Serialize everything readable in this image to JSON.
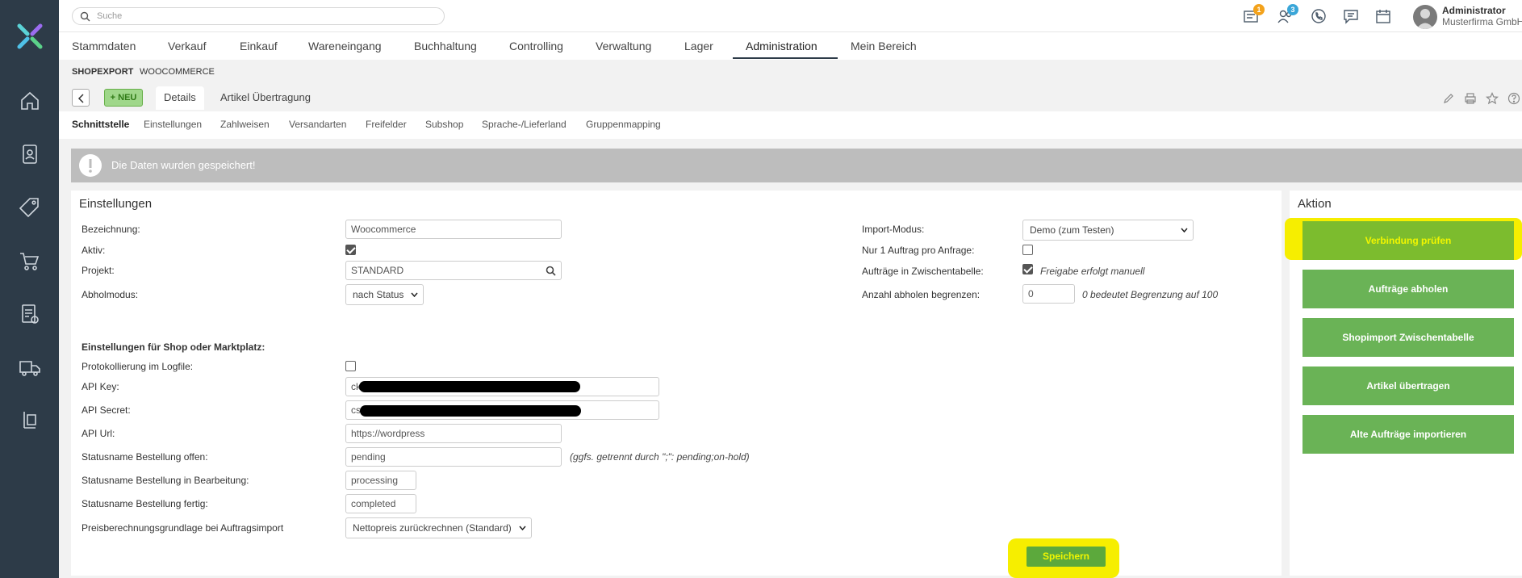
{
  "search": {
    "placeholder": "Suche"
  },
  "header": {
    "badges": {
      "tasks": "1",
      "users": "3"
    },
    "user_name": "Administrator",
    "user_company": "Musterfirma GmbH"
  },
  "nav": {
    "items": [
      "Stammdaten",
      "Verkauf",
      "Einkauf",
      "Wareneingang",
      "Buchhaltung",
      "Controlling",
      "Verwaltung",
      "Lager",
      "Administration",
      "Mein Bereich"
    ],
    "active": "Administration"
  },
  "breadcrumb": {
    "module": "SHOPEXPORT",
    "shop": "WOOCOMMERCE"
  },
  "tabs": {
    "new_label": "+ NEU",
    "details": "Details",
    "transfer": "Artikel Übertragung"
  },
  "subnav": [
    "Schnittstelle",
    "Einstellungen",
    "Zahlweisen",
    "Versandarten",
    "Freifelder",
    "Subshop",
    "Sprache-/Lieferland",
    "Gruppenmapping"
  ],
  "alert": {
    "text": "Die Daten wurden gespeichert!"
  },
  "settings": {
    "title": "Einstellungen",
    "bezeichnung_label": "Bezeichnung:",
    "bezeichnung_value": "Woocommerce",
    "aktiv_label": "Aktiv:",
    "projekt_label": "Projekt:",
    "projekt_value": "STANDARD",
    "abholmodus_label": "Abholmodus:",
    "abholmodus_value": "nach Status",
    "import_modus_label": "Import-Modus:",
    "import_modus_value": "Demo (zum Testen)",
    "ein_auftrag_label": "Nur 1 Auftrag pro Anfrage:",
    "zwischentabelle_label": "Aufträge in Zwischentabelle:",
    "zwischentabelle_hint": "Freigabe erfolgt manuell",
    "anzahl_label": "Anzahl abholen begrenzen:",
    "anzahl_value": "0",
    "anzahl_hint": "0 bedeutet Begrenzung auf 100",
    "shop_section": "Einstellungen für Shop oder Marktplatz:",
    "protokoll_label": "Protokollierung im Logfile:",
    "api_key_label": "API Key:",
    "api_key_prefix": "ck",
    "api_secret_label": "API Secret:",
    "api_secret_prefix": "cs",
    "api_url_label": "API Url:",
    "api_url_value": "https://wordpress",
    "status_offen_label": "Statusname Bestellung offen:",
    "status_offen_value": "pending",
    "status_offen_hint": "(ggfs. getrennt durch \";\": pending;on-hold)",
    "status_bearb_label": "Statusname Bestellung in Bearbeitung:",
    "status_bearb_value": "processing",
    "status_fertig_label": "Statusname Bestellung fertig:",
    "status_fertig_value": "completed",
    "preis_label": "Preisberechnungsgrundlage bei Auftragsimport",
    "preis_value": "Nettopreis zurückrechnen (Standard)",
    "save_label": "Speichern"
  },
  "actions": {
    "title": "Aktion",
    "buttons": [
      "Verbindung prüfen",
      "Aufträge abholen",
      "Shopimport Zwischentabelle",
      "Artikel übertragen",
      "Alte Aufträge importieren"
    ]
  },
  "colors": {
    "sidebar": "#2d3b48",
    "action_green": "#6ab356",
    "highlight": "#f6ee00",
    "highlight_text": "#f1f600",
    "alert_bg": "#bdbdbd"
  },
  "checkboxes": {
    "aktiv": true,
    "ein_auftrag": false,
    "zwischentabelle": true,
    "protokoll": false
  }
}
